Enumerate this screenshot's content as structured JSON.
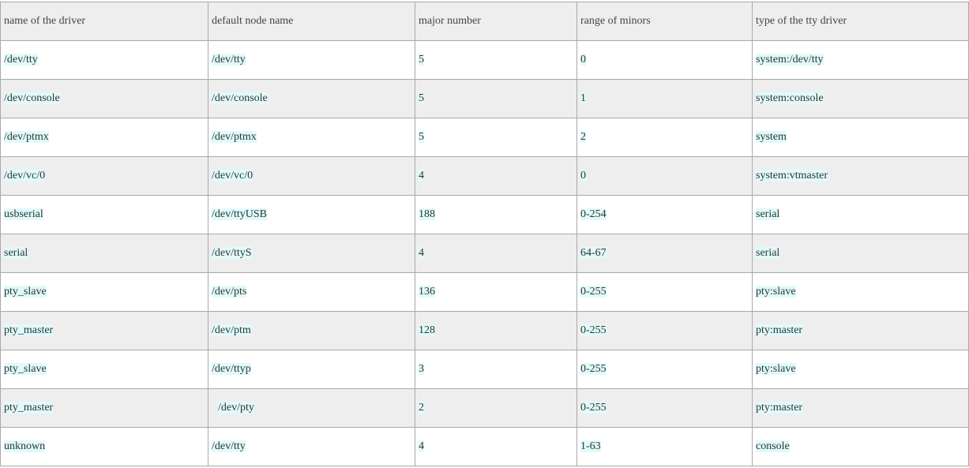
{
  "table": {
    "headers": [
      "name of the driver",
      "default node name",
      "major number",
      "range of minors",
      "type of the tty driver"
    ],
    "rows": [
      [
        "/dev/tty",
        "/dev/tty",
        "5",
        "0",
        "system:/dev/tty"
      ],
      [
        "/dev/console",
        "/dev/console",
        "5",
        "1",
        "system:console"
      ],
      [
        "/dev/ptmx",
        "/dev/ptmx",
        "5",
        "2",
        "system"
      ],
      [
        "/dev/vc/0",
        "/dev/vc/0",
        "4",
        "0",
        "system:vtmaster"
      ],
      [
        "usbserial",
        "/dev/ttyUSB",
        "188",
        "0-254",
        "serial"
      ],
      [
        "serial",
        "/dev/ttyS",
        "4",
        "64-67",
        "serial"
      ],
      [
        "pty_slave",
        "/dev/pts",
        "136",
        "0-255",
        "pty:slave"
      ],
      [
        "pty_master",
        "/dev/ptm",
        "128",
        "0-255",
        "pty:master"
      ],
      [
        "pty_slave",
        "/dev/ttyp",
        "3",
        "0-255",
        "pty:slave"
      ],
      [
        "pty_master",
        "/dev/pty",
        "2",
        "0-255",
        "pty:master"
      ],
      [
        "unknown",
        "/dev/tty",
        "4",
        "1-63",
        "console"
      ]
    ]
  }
}
